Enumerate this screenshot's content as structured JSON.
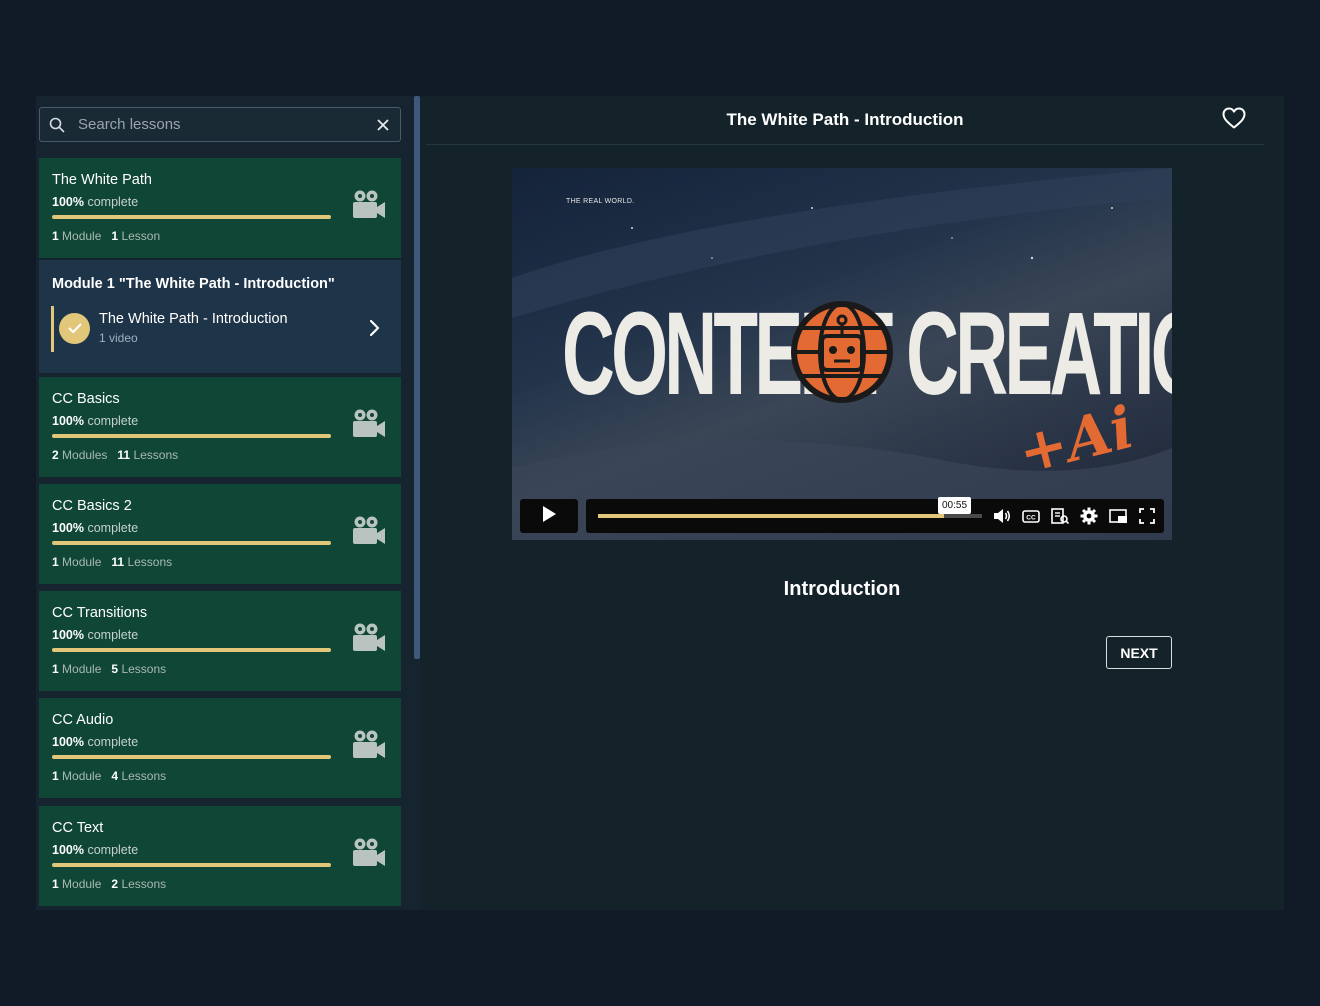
{
  "search": {
    "placeholder": "Search lessons"
  },
  "courses": [
    {
      "title": "The White Path",
      "percent": "100%",
      "percent_suffix": "complete",
      "progress": 1.0,
      "modules_count": "1",
      "modules_label": "Module",
      "lessons_count": "1",
      "lessons_label": "Lesson"
    },
    {
      "title": "CC Basics",
      "percent": "100%",
      "percent_suffix": "complete",
      "progress": 1.0,
      "modules_count": "2",
      "modules_label": "Modules",
      "lessons_count": "11",
      "lessons_label": "Lessons"
    },
    {
      "title": "CC Basics 2",
      "percent": "100%",
      "percent_suffix": "complete",
      "progress": 1.0,
      "modules_count": "1",
      "modules_label": "Module",
      "lessons_count": "11",
      "lessons_label": "Lessons"
    },
    {
      "title": "CC Transitions",
      "percent": "100%",
      "percent_suffix": "complete",
      "progress": 1.0,
      "modules_count": "1",
      "modules_label": "Module",
      "lessons_count": "5",
      "lessons_label": "Lessons"
    },
    {
      "title": "CC Audio",
      "percent": "100%",
      "percent_suffix": "complete",
      "progress": 1.0,
      "modules_count": "1",
      "modules_label": "Module",
      "lessons_count": "4",
      "lessons_label": "Lessons"
    },
    {
      "title": "CC Text",
      "percent": "100%",
      "percent_suffix": "complete",
      "progress": 1.0,
      "modules_count": "1",
      "modules_label": "Module",
      "lessons_count": "2",
      "lessons_label": "Lessons"
    }
  ],
  "module": {
    "title": "Module 1 \"The White Path - Introduction\"",
    "lesson_title": "The White Path - Introduction",
    "lesson_sub": "1 video"
  },
  "main": {
    "title": "The White Path - Introduction",
    "lesson_heading": "Introduction",
    "next_label": "NEXT"
  },
  "video": {
    "brand": "THE REAL WORLD.",
    "headline": "CONTENT CREATION",
    "accent": "+Ai",
    "time_tooltip": "00:55",
    "progress": 0.9
  },
  "colors": {
    "accent": "#e2c77a",
    "course_card": "#0f4636",
    "module_panel": "#1e3448",
    "background": "#111a27"
  },
  "icons": [
    "search-icon",
    "close-icon",
    "video-camera-icon",
    "check-icon",
    "chevron-right-icon",
    "heart-icon",
    "play-icon",
    "volume-icon",
    "captions-icon",
    "transcript-icon",
    "settings-icon",
    "pip-icon",
    "fullscreen-icon"
  ]
}
